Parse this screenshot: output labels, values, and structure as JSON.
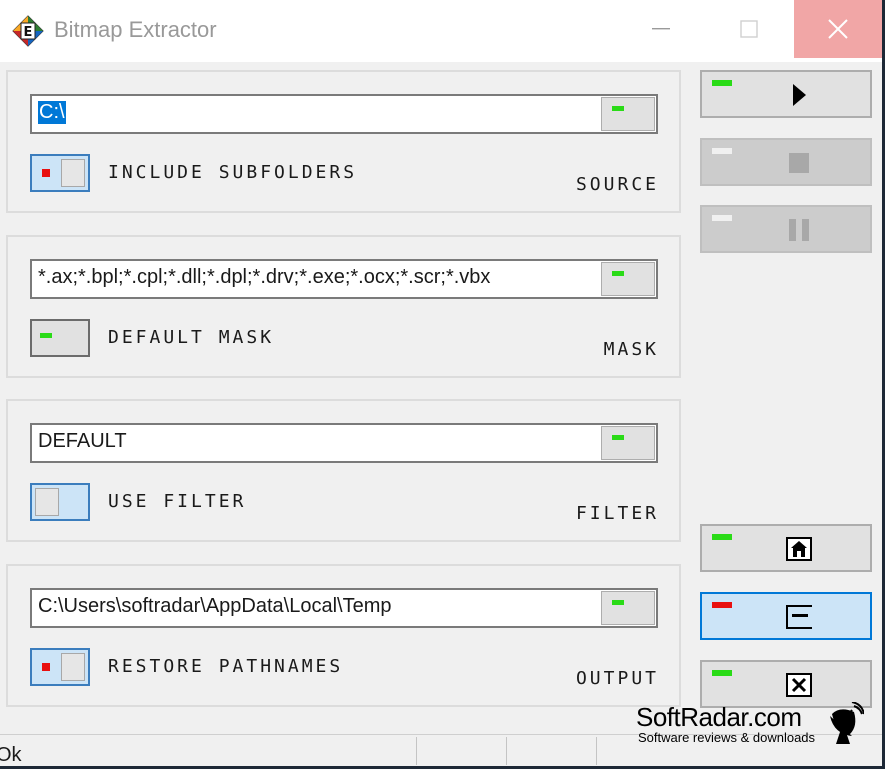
{
  "window": {
    "title": "Bitmap Extractor"
  },
  "groups": [
    {
      "id": "source",
      "field_value": "C:\\",
      "checkbox_label": "INCLUDE SUBFOLDERS",
      "checkbox_state": "on",
      "group_label": "SOURCE"
    },
    {
      "id": "mask",
      "field_value": "*.ax;*.bpl;*.cpl;*.dll;*.dpl;*.drv;*.exe;*.ocx;*.scr;*.vbx",
      "checkbox_label": "DEFAULT MASK",
      "checkbox_state": "off",
      "group_label": "MASK"
    },
    {
      "id": "filter",
      "field_value": "DEFAULT",
      "checkbox_label": "USE FILTER",
      "checkbox_state": "unchecked",
      "group_label": "FILTER"
    },
    {
      "id": "output",
      "field_value": "C:\\Users\\softradar\\AppData\\Local\\Temp",
      "checkbox_label": "RESTORE PATHNAMES",
      "checkbox_state": "on",
      "group_label": "OUTPUT"
    }
  ],
  "side_buttons": [
    {
      "id": "start",
      "icon": "play-icon",
      "state": "enabled",
      "led": "green"
    },
    {
      "id": "stop",
      "icon": "stop-icon",
      "state": "disabled",
      "led": "off"
    },
    {
      "id": "pause",
      "icon": "pause-icon",
      "state": "disabled",
      "led": "off"
    },
    {
      "id": "home",
      "icon": "home-icon",
      "state": "enabled",
      "led": "green"
    },
    {
      "id": "minimize",
      "icon": "minimize-box-icon",
      "state": "active",
      "led": "red"
    },
    {
      "id": "close",
      "icon": "close-box-icon",
      "state": "enabled",
      "led": "green"
    }
  ],
  "statusbar": {
    "text": "Ok"
  },
  "watermark": {
    "brand": "SoftRadar.com",
    "tagline": "Software reviews & downloads"
  },
  "colors": {
    "led_green": "#2adb17",
    "led_red": "#e81010",
    "selection": "#0078d7",
    "close_hover": "#f1a6a6"
  }
}
